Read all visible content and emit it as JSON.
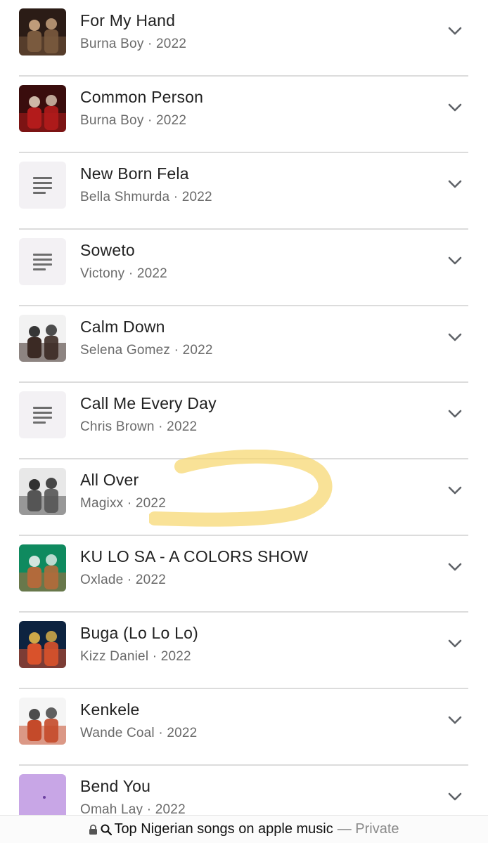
{
  "songs": [
    {
      "title": "For My Hand",
      "artist": "Burna Boy",
      "year": "2022",
      "thumb": "art-black-couple",
      "palette": [
        "#2b1c16",
        "#7a5a3e",
        "#d9b38c"
      ]
    },
    {
      "title": "Common Person",
      "artist": "Burna Boy",
      "year": "2022",
      "thumb": "art-red-collage",
      "palette": [
        "#3a0d0d",
        "#b31b1b",
        "#e9d7c3"
      ]
    },
    {
      "title": "New Born Fela",
      "artist": "Bella Shmurda",
      "year": "2022",
      "thumb": "lyrics-icon"
    },
    {
      "title": "Soweto",
      "artist": "Victony",
      "year": "2022",
      "thumb": "lyrics-icon"
    },
    {
      "title": "Calm Down",
      "artist": "Selena Gomez",
      "year": "2022",
      "thumb": "art-duo-white",
      "palette": [
        "#f2f2f2",
        "#3b2a24",
        "#151515"
      ]
    },
    {
      "title": "Call Me Every Day",
      "artist": "Chris Brown",
      "year": "2022",
      "thumb": "lyrics-icon"
    },
    {
      "title": "All Over",
      "artist": "Magixx",
      "year": "2022",
      "thumb": "art-bw-portrait",
      "palette": [
        "#e8e8e8",
        "#555555",
        "#111111"
      ]
    },
    {
      "title": "KU LO SA - A COLORS SHOW",
      "artist": "Oxlade",
      "year": "2022",
      "thumb": "art-green-colors",
      "palette": [
        "#0f8a5f",
        "#b26a3b",
        "#f4f4f4"
      ]
    },
    {
      "title": "Buga (Lo Lo Lo)",
      "artist": "Kizz Daniel",
      "year": "2022",
      "thumb": "art-blue-fire",
      "palette": [
        "#0d2340",
        "#d9522b",
        "#f0c04a"
      ]
    },
    {
      "title": "Kenkele",
      "artist": "Wande Coal",
      "year": "2022",
      "thumb": "art-white-suits",
      "palette": [
        "#f5f5f5",
        "#c44a2a",
        "#2e2e2e"
      ]
    },
    {
      "title": "Bend You",
      "artist": "Omah Lay",
      "year": "2022",
      "thumb": "art-lilac",
      "palette": [
        "#c8a6e6",
        "#b48ede",
        "#6b3fa0"
      ]
    }
  ],
  "separator": " · ",
  "highlight_color": "#f6d66b",
  "bottom_bar": {
    "search_text": "Top Nigerian songs on apple music",
    "mode_text": "— Private",
    "lock_icon": "lock-icon",
    "search_icon": "search-icon"
  }
}
